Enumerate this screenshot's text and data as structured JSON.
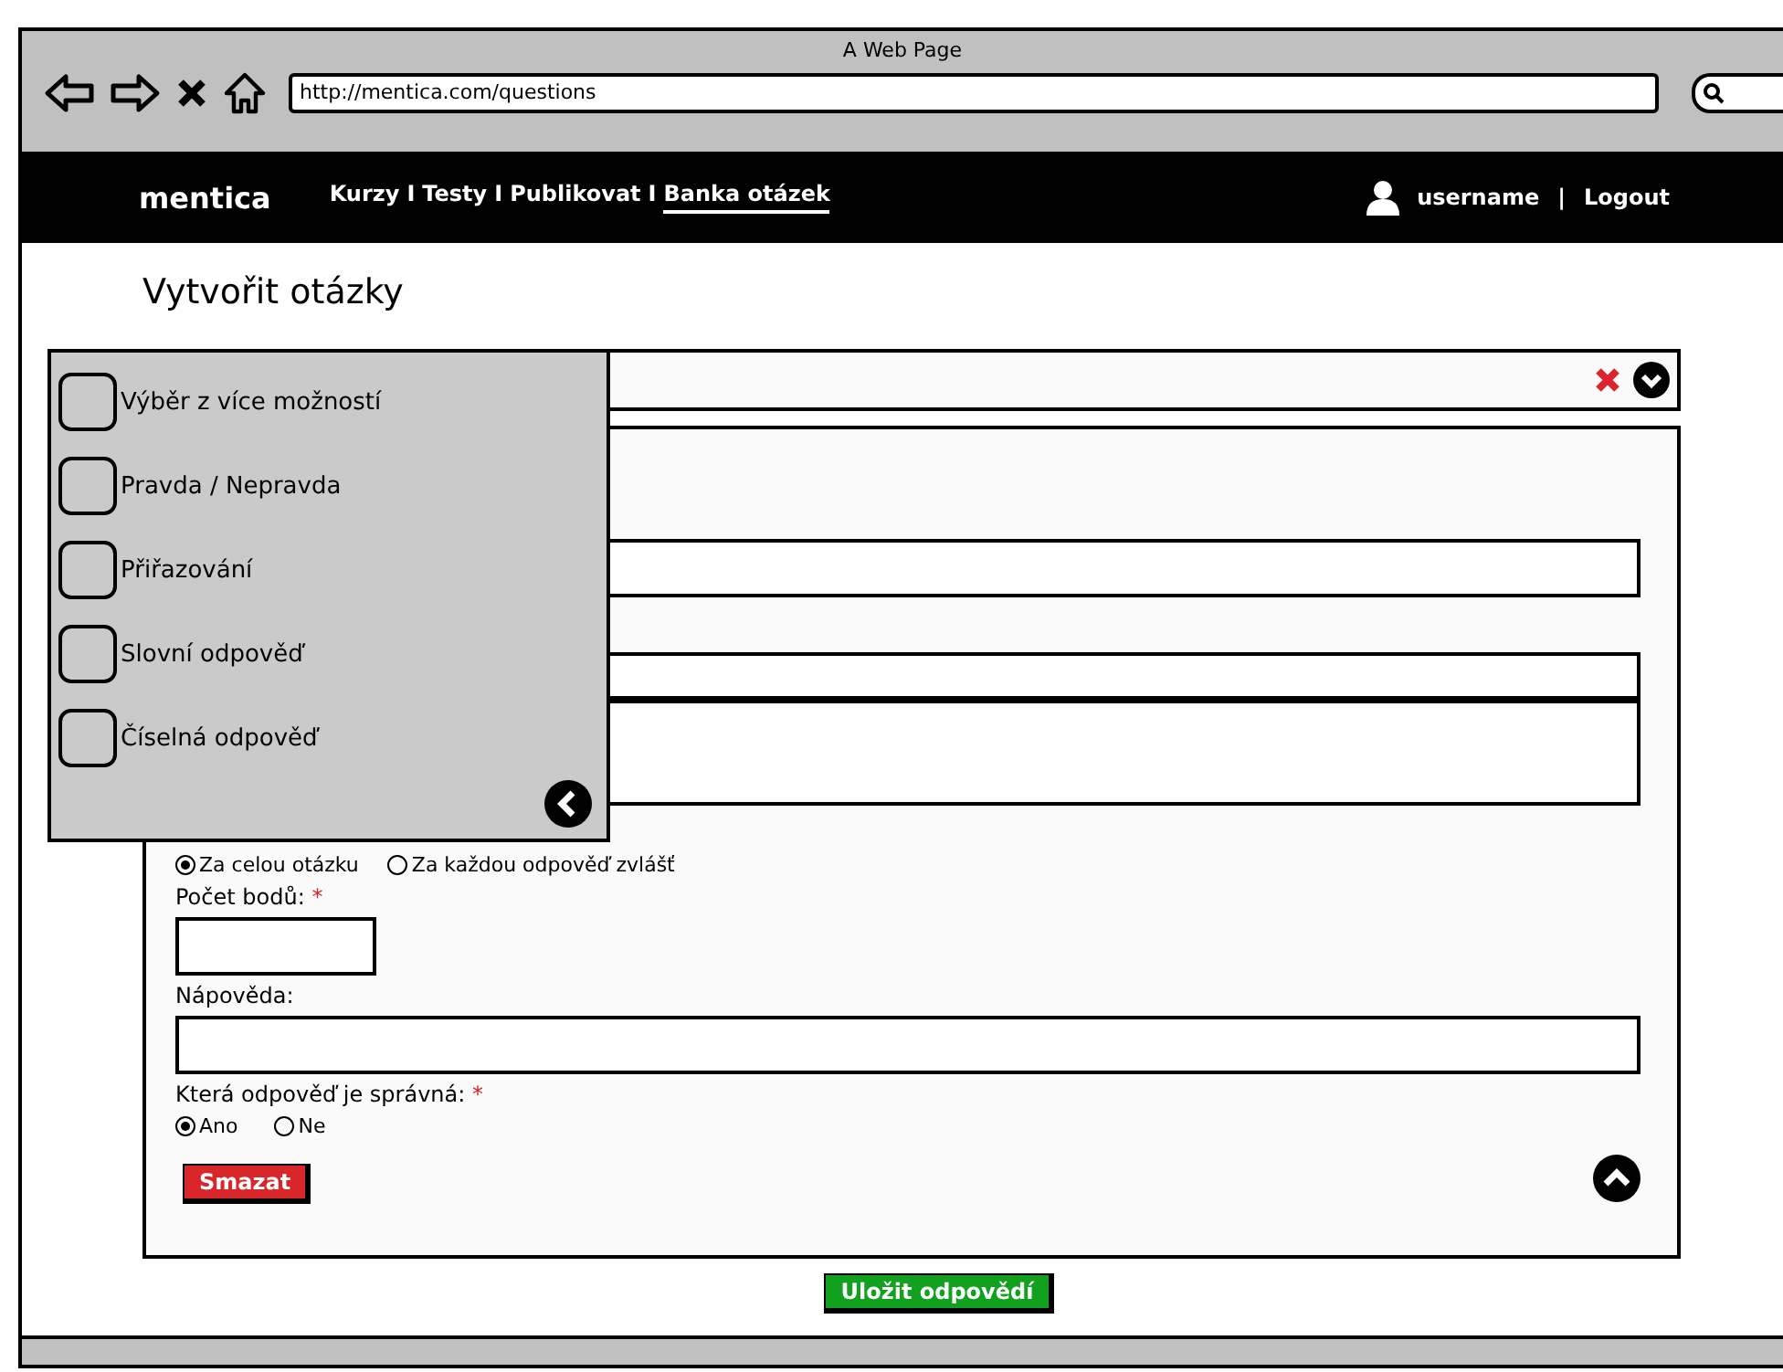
{
  "window": {
    "title": "A Web Page",
    "url": "http://mentica.com/questions"
  },
  "nav": {
    "logo": "mentica",
    "items": [
      {
        "kind": "link",
        "label": "Kurzy",
        "selected": false
      },
      {
        "kind": "separator",
        "label": "I"
      },
      {
        "kind": "link",
        "label": "Testy",
        "selected": false
      },
      {
        "kind": "separator",
        "label": "I"
      },
      {
        "kind": "link",
        "label": "Publikovat",
        "selected": false
      },
      {
        "kind": "separator",
        "label": "I"
      },
      {
        "kind": "link",
        "label": "Banka otázek",
        "selected": true
      }
    ],
    "user": "username",
    "user_separator": "|",
    "logout": "Logout"
  },
  "page_title": "Vytvořit otázky",
  "question_types": [
    {
      "label": "Výběr z více možností",
      "checked": false
    },
    {
      "label": "Pravda / Nepravda",
      "checked": false
    },
    {
      "label": "Přiřazování",
      "checked": false
    },
    {
      "label": "Slovní odpověď",
      "checked": false
    },
    {
      "label": "Číselná odpověď",
      "checked": false
    }
  ],
  "form": {
    "scoring": [
      {
        "label": "Za celou otázku",
        "selected": true
      },
      {
        "label": "Za každou odpověď zvlášť",
        "selected": false
      }
    ],
    "points_label": "Počet bodů:",
    "points_required": "*",
    "hint_label": "Nápověda:",
    "correct_label": "Která odpověď je správná:",
    "correct_required": "*",
    "correct_options": [
      {
        "label": "Ano",
        "selected": true
      },
      {
        "label": "Ne",
        "selected": false
      }
    ],
    "delete_button": "Smazat"
  },
  "save_button": "Uložit odpovědí"
}
